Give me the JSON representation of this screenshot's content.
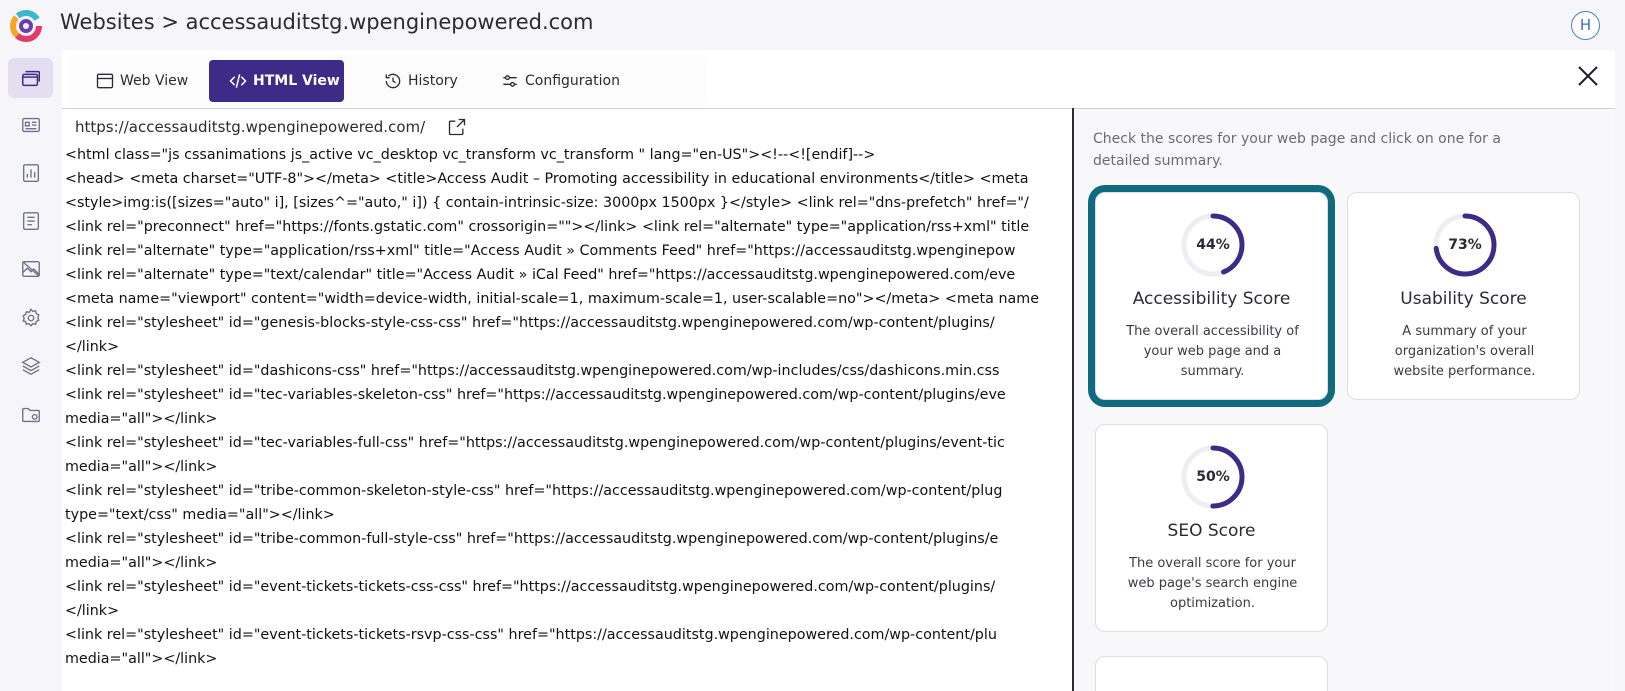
{
  "header": {
    "title": "Websites > accessauditstg.wpenginepowered.com",
    "avatar_initial": "H"
  },
  "sidebar": {
    "items": [
      {
        "icon": "windows-icon",
        "active": true
      },
      {
        "icon": "dashboard-card-icon",
        "active": false
      },
      {
        "icon": "report-chart-icon",
        "active": false
      },
      {
        "icon": "document-list-icon",
        "active": false
      },
      {
        "icon": "image-off-icon",
        "active": false
      },
      {
        "icon": "gear-icon",
        "active": false
      },
      {
        "icon": "layers-icon",
        "active": false
      },
      {
        "icon": "folder-settings-icon",
        "active": false
      }
    ]
  },
  "tabs": [
    {
      "label": "Web View",
      "icon": "browser-window-icon",
      "active": false
    },
    {
      "label": "HTML View",
      "icon": "code-icon",
      "active": true
    },
    {
      "label": "History",
      "icon": "history-icon",
      "active": false
    },
    {
      "label": "Configuration",
      "icon": "sliders-icon",
      "active": false
    }
  ],
  "source": {
    "url": "https://accessauditstg.wpenginepowered.com/",
    "lines": [
      "<html class=\"js cssanimations js_active vc_desktop vc_transform vc_transform \" lang=\"en-US\"><!--<![endif]-->",
      "<head> <meta charset=\"UTF-8\"></meta> <title>Access Audit – Promoting accessibility in educational environments</title> <meta",
      "<style>img:is([sizes=\"auto\" i], [sizes^=\"auto,\" i]) { contain-intrinsic-size: 3000px 1500px }</style> <link rel=\"dns-prefetch\" href=\"/",
      "<link rel=\"preconnect\" href=\"https://fonts.gstatic.com\" crossorigin=\"\"></link> <link rel=\"alternate\" type=\"application/rss+xml\" title",
      "<link rel=\"alternate\" type=\"application/rss+xml\" title=\"Access Audit » Comments Feed\" href=\"https://accessauditstg.wpenginepow",
      "<link rel=\"alternate\" type=\"text/calendar\" title=\"Access Audit » iCal Feed\" href=\"https://accessauditstg.wpenginepowered.com/eve",
      "<meta name=\"viewport\" content=\"width=device-width, initial-scale=1, maximum-scale=1, user-scalable=no\"></meta> <meta name",
      "<link rel=\"stylesheet\" id=\"genesis-blocks-style-css-css\" href=\"https://accessauditstg.wpenginepowered.com/wp-content/plugins/",
      "</link>",
      "<link rel=\"stylesheet\" id=\"dashicons-css\" href=\"https://accessauditstg.wpenginepowered.com/wp-includes/css/dashicons.min.css",
      "<link rel=\"stylesheet\" id=\"tec-variables-skeleton-css\" href=\"https://accessauditstg.wpenginepowered.com/wp-content/plugins/eve",
      "media=\"all\"></link>",
      "<link rel=\"stylesheet\" id=\"tec-variables-full-css\" href=\"https://accessauditstg.wpenginepowered.com/wp-content/plugins/event-tic",
      "media=\"all\"></link>",
      "<link rel=\"stylesheet\" id=\"tribe-common-skeleton-style-css\" href=\"https://accessauditstg.wpenginepowered.com/wp-content/plug",
      "type=\"text/css\" media=\"all\"></link>",
      "<link rel=\"stylesheet\" id=\"tribe-common-full-style-css\" href=\"https://accessauditstg.wpenginepowered.com/wp-content/plugins/e",
      "media=\"all\"></link>",
      "<link rel=\"stylesheet\" id=\"event-tickets-tickets-css-css\" href=\"https://accessauditstg.wpenginepowered.com/wp-content/plugins/",
      "</link>",
      "<link rel=\"stylesheet\" id=\"event-tickets-tickets-rsvp-css-css\" href=\"https://accessauditstg.wpenginepowered.com/wp-content/plu",
      "media=\"all\"></link>"
    ]
  },
  "scores": {
    "hint": "Check the scores for your web page and click on one for a detailed summary.",
    "ring_color": "#3e2a87",
    "selected_border_color": "#0f6a80",
    "cards": [
      {
        "percent": 44,
        "label": "44%",
        "title": "Accessibility Score",
        "description": "The overall accessibility of your web page and a summary.",
        "selected": true
      },
      {
        "percent": 73,
        "label": "73%",
        "title": "Usability Score",
        "description": "A summary of your organization's overall website performance.",
        "selected": false
      },
      {
        "percent": 50,
        "label": "50%",
        "title": "SEO Score",
        "description": "The overall score for your web page's search engine optimization.",
        "selected": false
      }
    ]
  }
}
